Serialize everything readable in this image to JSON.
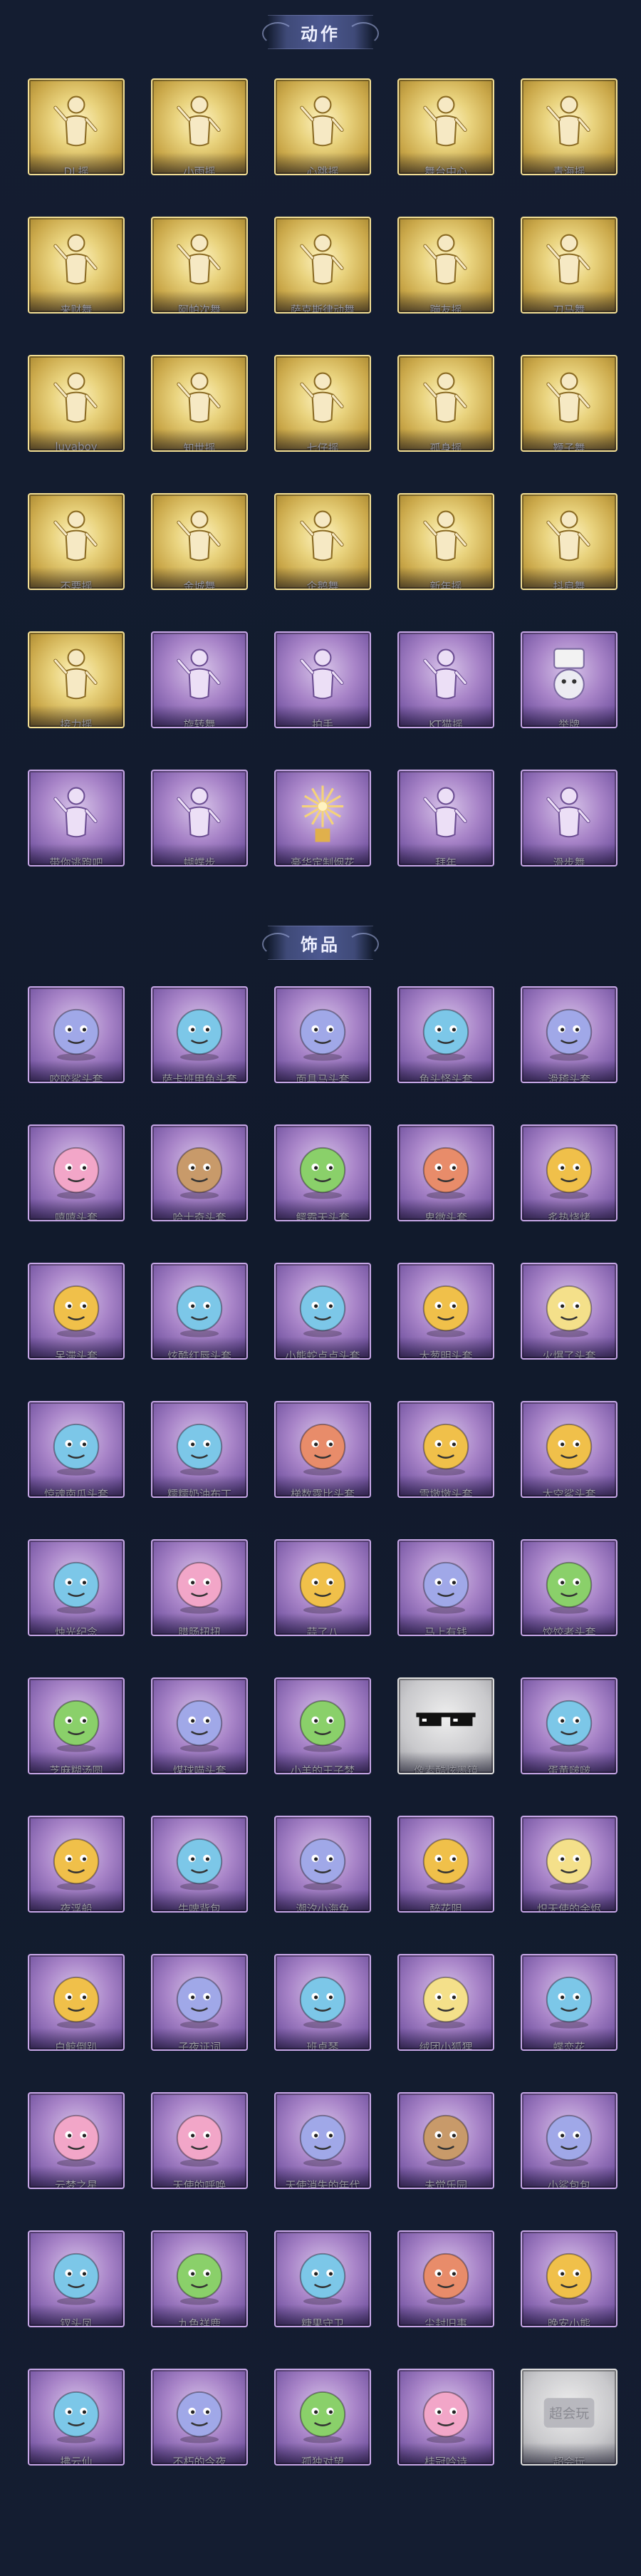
{
  "sections": {
    "actions": {
      "title": "动作",
      "items": [
        {
          "label": "DL摇",
          "tier": "gold",
          "icon": "pose-figure-icon"
        },
        {
          "label": "小雨摇",
          "tier": "gold",
          "icon": "pose-figure-icon"
        },
        {
          "label": "心跳摇",
          "tier": "gold",
          "icon": "pose-figure-icon"
        },
        {
          "label": "舞台中心",
          "tier": "gold",
          "icon": "pose-figure-icon"
        },
        {
          "label": "青海摇",
          "tier": "gold",
          "icon": "pose-figure-icon"
        },
        {
          "label": "来财舞",
          "tier": "gold",
          "icon": "pose-figure-icon"
        },
        {
          "label": "阿帕次舞",
          "tier": "gold",
          "icon": "pose-figure-icon"
        },
        {
          "label": "萨克斯律动舞",
          "tier": "gold",
          "icon": "pose-figure-icon"
        },
        {
          "label": "蹦友摇",
          "tier": "gold",
          "icon": "pose-figure-icon"
        },
        {
          "label": "刀马舞",
          "tier": "gold",
          "icon": "pose-figure-icon"
        },
        {
          "label": "luvaboy",
          "tier": "gold",
          "icon": "pose-figure-icon"
        },
        {
          "label": "知世摇",
          "tier": "gold",
          "icon": "pose-figure-icon"
        },
        {
          "label": "七仔摇",
          "tier": "gold",
          "icon": "pose-figure-icon"
        },
        {
          "label": "孤身摇",
          "tier": "gold",
          "icon": "pose-figure-icon"
        },
        {
          "label": "鞭子舞",
          "tier": "gold",
          "icon": "pose-figure-icon"
        },
        {
          "label": "不要摇",
          "tier": "gold",
          "icon": "pose-figure-icon"
        },
        {
          "label": "金城舞",
          "tier": "gold",
          "icon": "pose-figure-icon"
        },
        {
          "label": "企鹅舞",
          "tier": "gold",
          "icon": "pose-figure-icon"
        },
        {
          "label": "新年摇",
          "tier": "gold",
          "icon": "pose-figure-icon"
        },
        {
          "label": "抖肩舞",
          "tier": "gold",
          "icon": "pose-figure-icon"
        },
        {
          "label": "接力摇",
          "tier": "gold",
          "icon": "pose-figure-icon"
        },
        {
          "label": "旋转舞",
          "tier": "purple",
          "icon": "pose-figure-icon"
        },
        {
          "label": "拍手",
          "tier": "purple",
          "icon": "hand-clap-icon"
        },
        {
          "label": "KT猫摇",
          "tier": "purple",
          "icon": "pose-figure-icon"
        },
        {
          "label": "举牌",
          "tier": "purple",
          "icon": "sign-bear-icon"
        },
        {
          "label": "带你逃跑吧",
          "tier": "purple",
          "icon": "pose-figure-icon"
        },
        {
          "label": "蝴蝶步",
          "tier": "purple",
          "icon": "pose-figure-icon"
        },
        {
          "label": "豪华定制烟花",
          "tier": "purple",
          "icon": "firework-icon"
        },
        {
          "label": "拜年",
          "tier": "purple",
          "icon": "pose-figure-icon"
        },
        {
          "label": "滑步舞",
          "tier": "purple",
          "icon": "pose-figure-icon"
        }
      ]
    },
    "accessories": {
      "title": "饰品",
      "items": [
        {
          "label": "咬咬鲨头套",
          "tier": "purple",
          "icon": "shark-head-icon"
        },
        {
          "label": "萨卡班甲鱼头套",
          "tier": "purple",
          "icon": "fish-head-icon"
        },
        {
          "label": "面具马头套",
          "tier": "purple",
          "icon": "horse-head-icon"
        },
        {
          "label": "鱼头怪头套",
          "tier": "purple",
          "icon": "fish-monster-icon"
        },
        {
          "label": "滑稽头套",
          "tier": "purple",
          "icon": "funny-face-icon"
        },
        {
          "label": "嘻嘻头套",
          "tier": "purple",
          "icon": "grin-face-icon"
        },
        {
          "label": "哈士奇头套",
          "tier": "purple",
          "icon": "husky-head-icon"
        },
        {
          "label": "鳄霸天头套",
          "tier": "purple",
          "icon": "crocodile-head-icon"
        },
        {
          "label": "卑微头套",
          "tier": "purple",
          "icon": "sad-face-icon"
        },
        {
          "label": "炙热烧烤",
          "tier": "purple",
          "icon": "grill-icon"
        },
        {
          "label": "呆滞头套",
          "tier": "purple",
          "icon": "dazed-face-icon"
        },
        {
          "label": "炫酷红唇头套",
          "tier": "purple",
          "icon": "cool-pikachu-icon"
        },
        {
          "label": "小熊蛇点点头套",
          "tier": "purple",
          "icon": "snake-head-icon"
        },
        {
          "label": "大葱明头套",
          "tier": "purple",
          "icon": "scallion-head-icon"
        },
        {
          "label": "火爆了头套",
          "tier": "purple",
          "icon": "fire-head-icon"
        },
        {
          "label": "惊魂南瓜头套",
          "tier": "purple",
          "icon": "pumpkin-head-icon"
        },
        {
          "label": "糯糯奶油布丁",
          "tier": "purple",
          "icon": "pudding-icon"
        },
        {
          "label": "梯数露比头套",
          "tier": "purple",
          "icon": "pink-beaver-icon"
        },
        {
          "label": "雪墩墩头套",
          "tier": "purple",
          "icon": "snowman-head-icon"
        },
        {
          "label": "太空鲨头套",
          "tier": "purple",
          "icon": "space-shark-icon"
        },
        {
          "label": "烛光纪念",
          "tier": "purple",
          "icon": "candle-icon"
        },
        {
          "label": "腊肠扭扭",
          "tier": "purple",
          "icon": "sausage-dog-icon"
        },
        {
          "label": "蒜了八",
          "tier": "purple",
          "icon": "garlic-icon"
        },
        {
          "label": "马上有钱",
          "tier": "purple",
          "icon": "money-horse-icon"
        },
        {
          "label": "饺饺者头套",
          "tier": "purple",
          "icon": "dumpling-head-icon"
        },
        {
          "label": "芝麻糊汤圆",
          "tier": "purple",
          "icon": "rice-ball-icon"
        },
        {
          "label": "煤球喵头套",
          "tier": "purple",
          "icon": "black-cat-icon"
        },
        {
          "label": "小羊的王子梦",
          "tier": "purple",
          "icon": "sheep-prince-icon"
        },
        {
          "label": "像素酷炫墨镜",
          "tier": "gray",
          "icon": "pixel-sunglasses-icon"
        },
        {
          "label": "蛋黄啵啵",
          "tier": "purple",
          "icon": "egg-yolk-icon"
        },
        {
          "label": "夜浮船",
          "tier": "purple",
          "icon": "jellyfish-icon"
        },
        {
          "label": "牛啤背包",
          "tier": "purple",
          "icon": "beer-backpack-icon"
        },
        {
          "label": "潮汐小海兔",
          "tier": "purple",
          "icon": "sea-bunny-icon"
        },
        {
          "label": "醉花阴",
          "tier": "purple",
          "icon": "flower-ornament-icon"
        },
        {
          "label": "炽天使的余烬",
          "tier": "purple",
          "icon": "angel-doll-icon"
        },
        {
          "label": "白鲸倒趴",
          "tier": "purple",
          "icon": "beluga-icon"
        },
        {
          "label": "子夜证词",
          "tier": "purple",
          "icon": "night-doll-icon"
        },
        {
          "label": "班卓琴",
          "tier": "purple",
          "icon": "banjo-pig-icon"
        },
        {
          "label": "绒团小狐狸",
          "tier": "purple",
          "icon": "fox-icon"
        },
        {
          "label": "蝶恋花",
          "tier": "purple",
          "icon": "butterfly-charm-icon"
        },
        {
          "label": "云梦之星",
          "tier": "purple",
          "icon": "cloud-star-icon"
        },
        {
          "label": "天使的呼唤",
          "tier": "purple",
          "icon": "angel-call-icon"
        },
        {
          "label": "天使消失的年代",
          "tier": "purple",
          "icon": "lost-angel-icon"
        },
        {
          "label": "未觉乐园",
          "tier": "purple",
          "icon": "paradise-doll-icon"
        },
        {
          "label": "小鲨包包",
          "tier": "purple",
          "icon": "shark-bag-icon"
        },
        {
          "label": "钗头凤",
          "tier": "purple",
          "icon": "hairpin-phoenix-icon"
        },
        {
          "label": "九色祥鹿",
          "tier": "purple",
          "icon": "nine-color-deer-icon"
        },
        {
          "label": "糖果守卫",
          "tier": "purple",
          "icon": "candy-guard-icon"
        },
        {
          "label": "尘封旧事",
          "tier": "purple",
          "icon": "dusty-tale-icon"
        },
        {
          "label": "晚安小熊",
          "tier": "purple",
          "icon": "goodnight-bear-icon"
        },
        {
          "label": "拂云仙",
          "tier": "purple",
          "icon": "cloud-fairy-icon"
        },
        {
          "label": "不朽的今夜",
          "tier": "purple",
          "icon": "eternal-night-icon"
        },
        {
          "label": "孤独对望",
          "tier": "purple",
          "icon": "lonely-gaze-icon"
        },
        {
          "label": "桂冠吟诗",
          "tier": "purple",
          "icon": "laurel-poet-icon"
        },
        {
          "label": "超会玩",
          "tier": "gray",
          "icon": "brand-logo-icon"
        }
      ]
    }
  },
  "colors": {
    "background": "#131c30",
    "gold_frame": "#f2de94",
    "purple_frame": "#c6a6e6",
    "banner": "#4c5890",
    "label_text": "#ffffff"
  }
}
